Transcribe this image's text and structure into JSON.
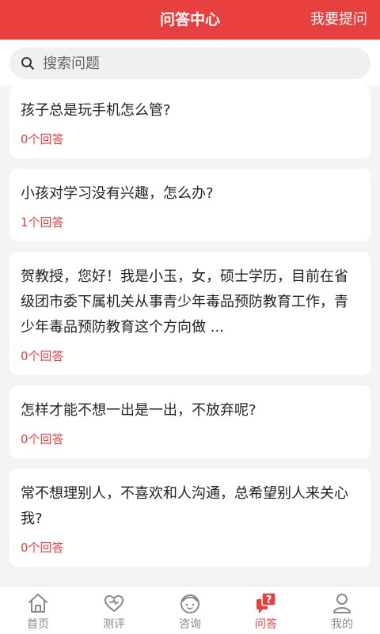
{
  "header": {
    "title": "问答中心",
    "ask_button": "我要提问"
  },
  "search": {
    "placeholder": "搜索问题"
  },
  "questions": [
    {
      "text": "孩子总是玩手机怎么管?",
      "answers": "0个回答"
    },
    {
      "text": "小孩对学习没有兴趣，怎么办?",
      "answers": "1个回答"
    },
    {
      "text": "贺教授，您好！我是小玉，女，硕士学历，目前在省级团市委下属机关从事青少年毒品预防教育工作，青少年毒品预防教育这个方向做 ...",
      "answers": "0个回答"
    },
    {
      "text": "怎样才能不想一出是一出，不放弃呢?",
      "answers": "0个回答"
    },
    {
      "text": "常不想理别人，不喜欢和人沟通，总希望别人来关心我?",
      "answers": "0个回答"
    }
  ],
  "tabs": [
    {
      "label": "首页",
      "icon": "home-icon"
    },
    {
      "label": "测评",
      "icon": "heart-icon"
    },
    {
      "label": "咨询",
      "icon": "counselor-icon"
    },
    {
      "label": "问答",
      "icon": "question-chat-icon",
      "active": true
    },
    {
      "label": "我的",
      "icon": "user-icon"
    }
  ],
  "colors": {
    "accent": "#e8403f",
    "inactive": "#888888"
  }
}
